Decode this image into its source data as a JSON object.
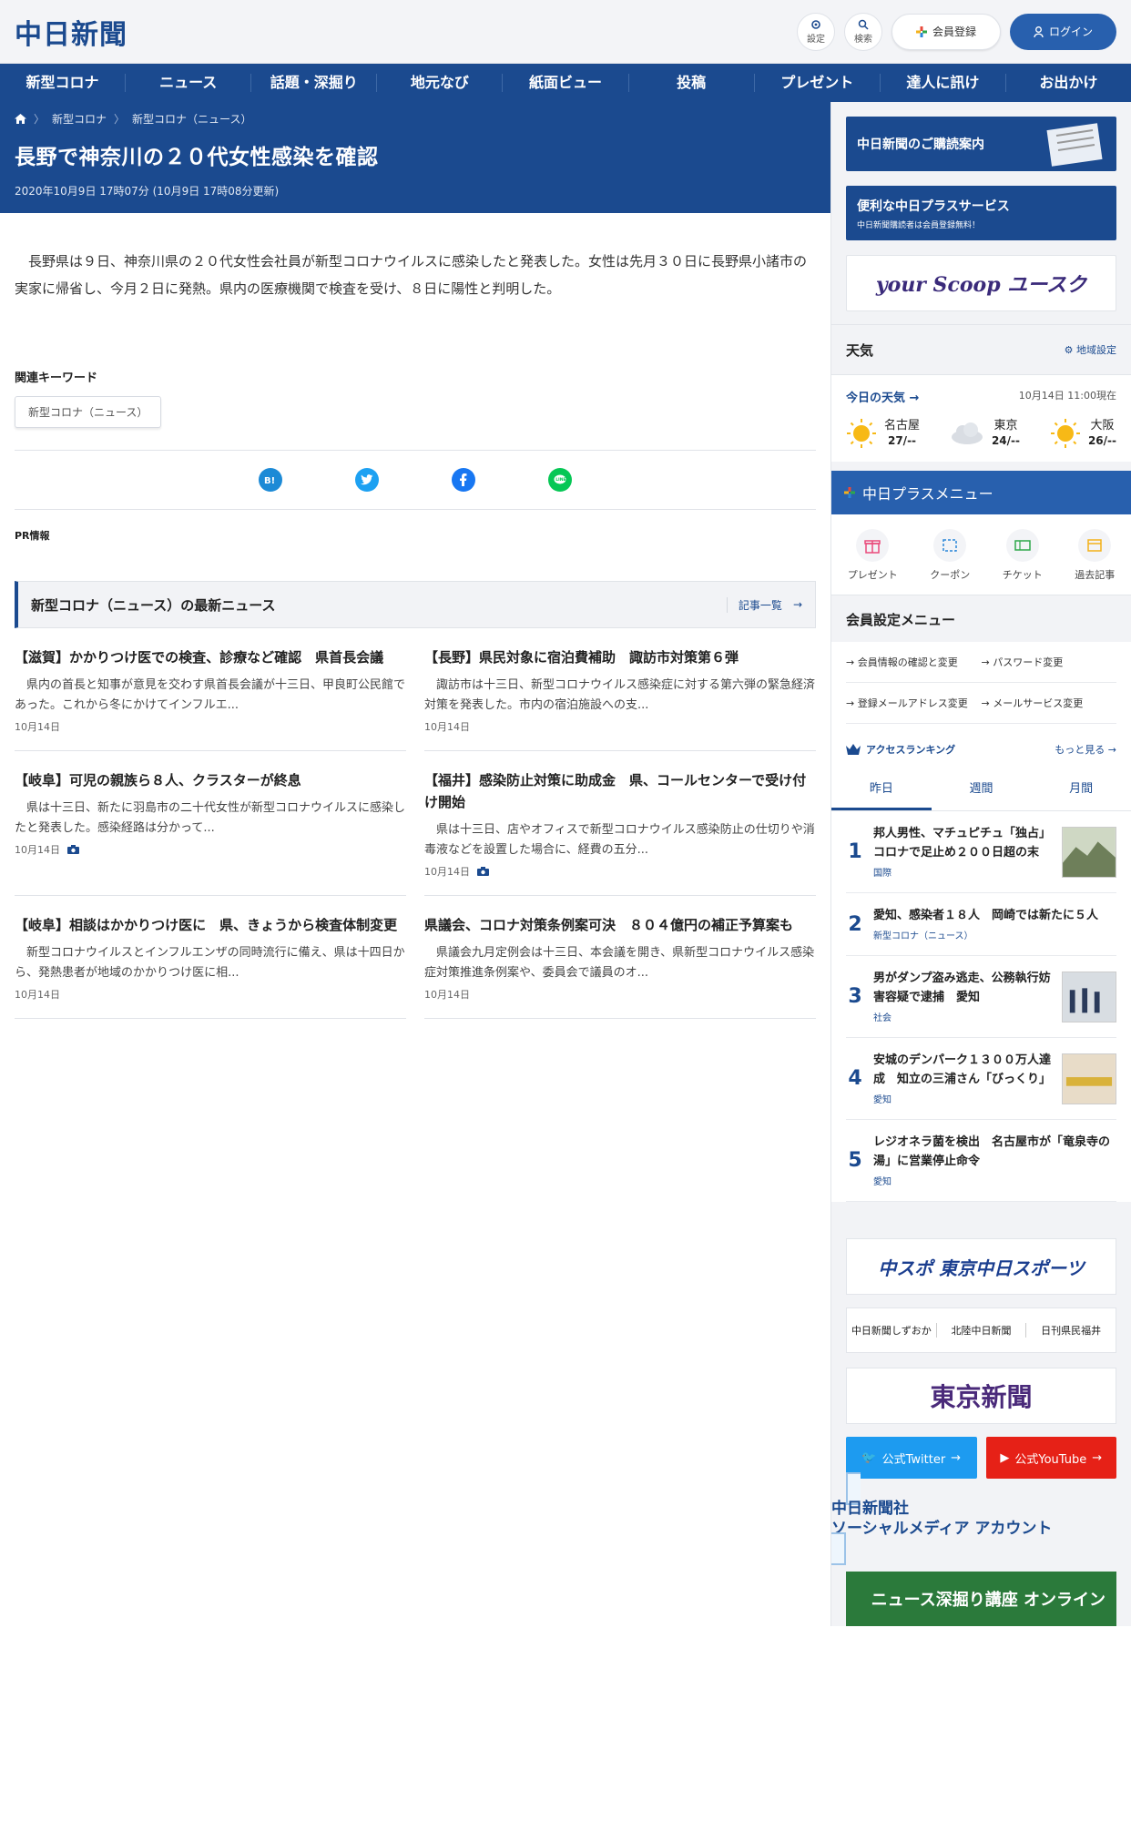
{
  "header": {
    "logo": "中日新聞",
    "settings_label": "設定",
    "search_label": "検索",
    "register_label": "会員登録",
    "login_label": "ログイン"
  },
  "nav": [
    "新型コロナ",
    "ニュース",
    "話題・深掘り",
    "地元なび",
    "紙面ビュー",
    "投稿",
    "プレゼント",
    "達人に訊け",
    "お出かけ"
  ],
  "breadcrumb": [
    "新型コロナ",
    "新型コロナ（ニュース）"
  ],
  "article": {
    "title": "長野で神奈川の２０代女性感染を確認",
    "date": "2020年10月9日 17時07分 (10月9日 17時08分更新)",
    "body": "長野県は９日、神奈川県の２０代女性会社員が新型コロナウイルスに感染したと発表した。女性は先月３０日に長野県小諸市の実家に帰省し、今月２日に発熱。県内の医療機関で検査を受け、８日に陽性と判明した。",
    "keyword_title": "関連キーワード",
    "keyword": "新型コロナ（ニュース）",
    "pr": "PR情報"
  },
  "latest": {
    "title": "新型コロナ（ニュース）の最新ニュース",
    "more": "記事一覧",
    "items": [
      {
        "title": "【滋賀】かかりつけ医での検査、診療など確認　県首長会議",
        "desc": "県内の首長と知事が意見を交わす県首長会議が十三日、甲良町公民館であった。これから冬にかけてインフルエ...",
        "date": "10月14日"
      },
      {
        "title": "【長野】県民対象に宿泊費補助　諏訪市対策第６弾",
        "desc": "諏訪市は十三日、新型コロナウイルス感染症に対する第六弾の緊急経済対策を発表した。市内の宿泊施設への支...",
        "date": "10月14日"
      },
      {
        "title": "【岐阜】可児の親族ら８人、クラスターが終息",
        "desc": "県は十三日、新たに羽島市の二十代女性が新型コロナウイルスに感染したと発表した。感染経路は分かって...",
        "date": "10月14日"
      },
      {
        "title": "【福井】感染防止対策に助成金　県、コールセンターで受け付け開始",
        "desc": "県は十三日、店やオフィスで新型コロナウイルス感染防止の仕切りや消毒液などを設置した場合に、経費の五分...",
        "date": "10月14日"
      },
      {
        "title": "【岐阜】相談はかかりつけ医に　県、きょうから検査体制変更",
        "desc": "新型コロナウイルスとインフルエンザの同時流行に備え、県は十四日から、発熱患者が地域のかかりつけ医に相...",
        "date": "10月14日"
      },
      {
        "title": "県議会、コロナ対策条例案可決　８０４億円の補正予算案も",
        "desc": "県議会九月定例会は十三日、本会議を開き、県新型コロナウイルス感染症対策推進条例案や、委員会で議員のオ...",
        "date": "10月14日"
      }
    ]
  },
  "sidebar": {
    "banner1": "中日新聞のご購読案内",
    "banner2": "便利な中日プラスサービス",
    "banner2_sub": "中日新聞購読者は会員登録無料！",
    "banner3": "your Scoop ユースク",
    "weather_title": "天気",
    "weather_setting": "地域設定",
    "weather_today": "今日の天気",
    "weather_time": "10月14日 11:00現在",
    "cities": [
      {
        "name": "名古屋",
        "temp": "27/--"
      },
      {
        "name": "東京",
        "temp": "24/--"
      },
      {
        "name": "大阪",
        "temp": "26/--"
      }
    ],
    "plus_menu_title": "中日プラスメニュー",
    "plus_menu": [
      "プレゼント",
      "クーポン",
      "チケット",
      "過去記事"
    ],
    "member_title": "会員設定メニュー",
    "member_links": [
      "会員情報の確認と変更",
      "パスワード変更",
      "登録メールアドレス変更",
      "メールサービス変更"
    ],
    "ranking_title": "アクセスランキング",
    "ranking_more": "もっと見る",
    "ranking_tabs": [
      "昨日",
      "週間",
      "月間"
    ],
    "ranking": [
      {
        "num": "1",
        "title": "邦人男性、マチュピチュ「独占」　コロナで足止め２００日超の末",
        "cat": "国際"
      },
      {
        "num": "2",
        "title": "愛知、感染者１８人　岡崎では新たに５人",
        "cat": "新型コロナ（ニュース）"
      },
      {
        "num": "3",
        "title": "男がダンプ盗み逃走、公務執行妨害容疑で逮捕　愛知",
        "cat": "社会"
      },
      {
        "num": "4",
        "title": "安城のデンパーク１３００万人達成　知立の三浦さん「びっくり」",
        "cat": "愛知"
      },
      {
        "num": "5",
        "title": "レジオネラ菌を検出　名古屋市が「竜泉寺の湯」に営業停止命令",
        "cat": "愛知"
      }
    ],
    "chuspo": "中スポ 東京中日スポーツ",
    "links3": [
      "中日新聞しずおか",
      "北陸中日新聞",
      "日刊県民福井"
    ],
    "tokyo": "東京新聞",
    "twitter": "公式Twitter",
    "youtube": "公式YouTube",
    "social_media": "中日新聞社",
    "social_media2": "ソーシャルメディア アカウント",
    "course": "ニュース深掘り講座 オンライン"
  }
}
